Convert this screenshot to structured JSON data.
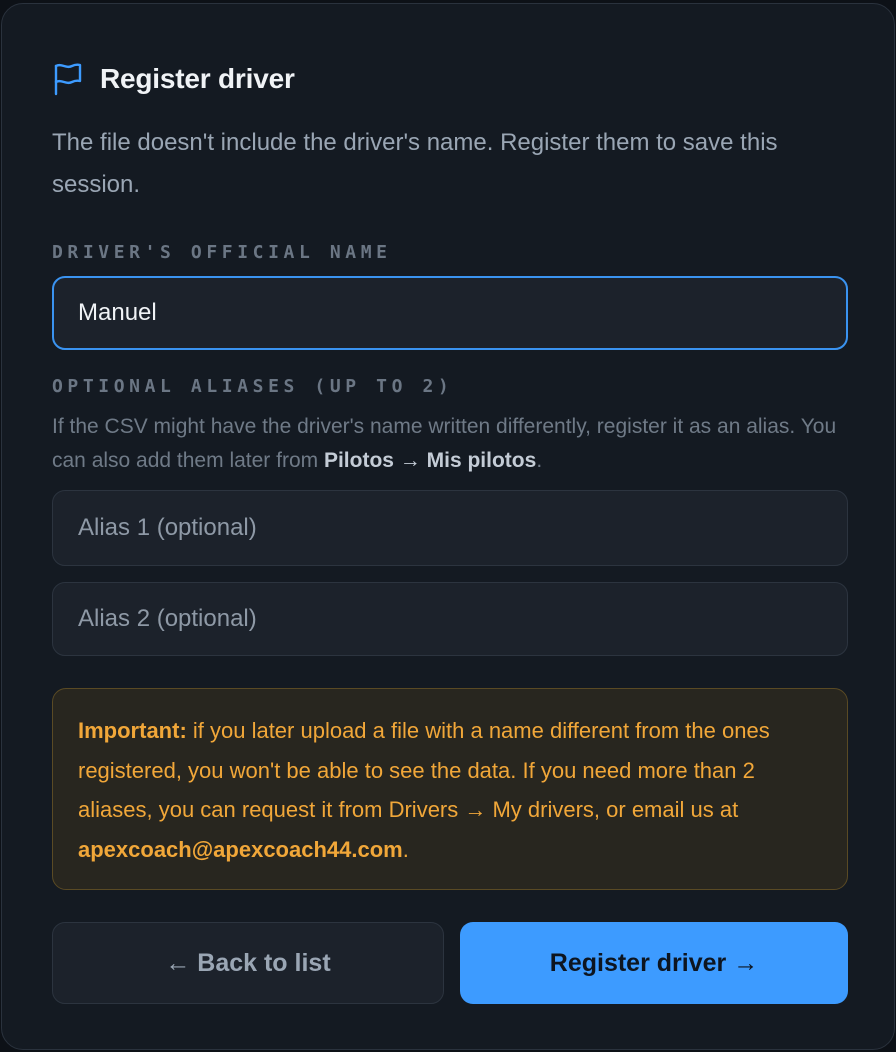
{
  "header": {
    "icon": "flag-icon",
    "title": "Register driver"
  },
  "description": "The file doesn't include the driver's name. Register them to save this session.",
  "official_name": {
    "label": "DRIVER'S OFFICIAL NAME",
    "value": "Manuel"
  },
  "aliases": {
    "label": "OPTIONAL ALIASES (UP TO 2)",
    "help_prefix": "If the CSV might have the driver's name written differently, register it as an alias. You can also add them later from ",
    "help_link": "Pilotos → Mis pilotos",
    "help_suffix": ".",
    "alias1_placeholder": "Alias 1 (optional)",
    "alias2_placeholder": "Alias 2 (optional)"
  },
  "warning": {
    "strong": "Important:",
    "text": " if you later upload a file with a name different from the ones registered, you won't be able to see the data. If you need more than 2 aliases, you can request it from Drivers → My drivers, or email us at ",
    "email": "apexcoach@apexcoach44.com",
    "suffix": "."
  },
  "actions": {
    "back_label": "← Back to list",
    "register_label": "Register driver →"
  },
  "colors": {
    "accent": "#3d9bff",
    "warning": "#f1a739",
    "background": "#141a22"
  }
}
